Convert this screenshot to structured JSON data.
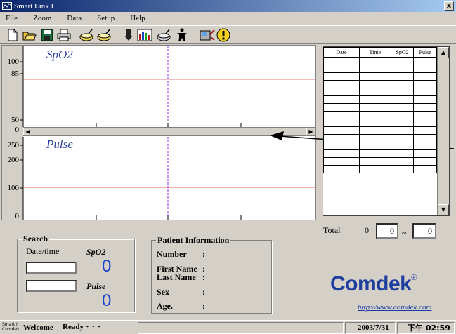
{
  "window": {
    "title": "Smart Link I",
    "close_label": "x"
  },
  "menu": [
    "File",
    "Zoom",
    "Data",
    "Setup",
    "Help"
  ],
  "toolbar": {
    "buttons": [
      "new-file-icon",
      "open-folder-icon",
      "save-disk-icon",
      "print-icon",
      "pot-1-icon",
      "pot-2-icon",
      "download-arrow-icon",
      "bar-chart-icon",
      "pot-3-icon",
      "person-icon",
      "device-icon",
      "alert-icon"
    ]
  },
  "charts": {
    "spo2": {
      "title": "SpO2",
      "yticks": [
        "100",
        "85",
        "50",
        "0"
      ],
      "threshold_value": 85,
      "threshold_color": "#e05050"
    },
    "pulse": {
      "title": "Pulse",
      "yticks": [
        "250",
        "200",
        "100",
        "0"
      ],
      "threshold_value": 100,
      "threshold_color": "#e05050"
    },
    "cursor_color": "#8a2be2"
  },
  "table": {
    "headers": [
      "Date",
      "Time",
      "SpO2",
      "Pulse"
    ],
    "row_count": 15
  },
  "total": {
    "label": "Total",
    "count": "0",
    "from": "0",
    "to": "0",
    "separator": "~"
  },
  "search": {
    "legend": "Search",
    "date_label": "Date/time",
    "spo2_label": "SpO2",
    "pulse_label": "Pulse",
    "spo2_value": "0",
    "pulse_value": "0"
  },
  "patient": {
    "legend": "Patient Information",
    "fields": [
      {
        "label": "Number",
        "value": ":"
      },
      {
        "label": "First Name",
        "value": ":"
      },
      {
        "label": "Last Name",
        "value": ":"
      },
      {
        "label": "Sex",
        "value": ":"
      },
      {
        "label": "Age.",
        "value": ":"
      }
    ]
  },
  "brand": {
    "logo": "Comdek",
    "reg": "®",
    "url": "http://www.comdek.com",
    "color": "#1f3f9e"
  },
  "status": {
    "app_tag_line1": "Smart I",
    "app_tag_line2": "Comdek",
    "welcome": "Welcome",
    "ready": "Ready ･ ･ ･",
    "date": "2003/7/31",
    "time": "下午 02:59"
  }
}
